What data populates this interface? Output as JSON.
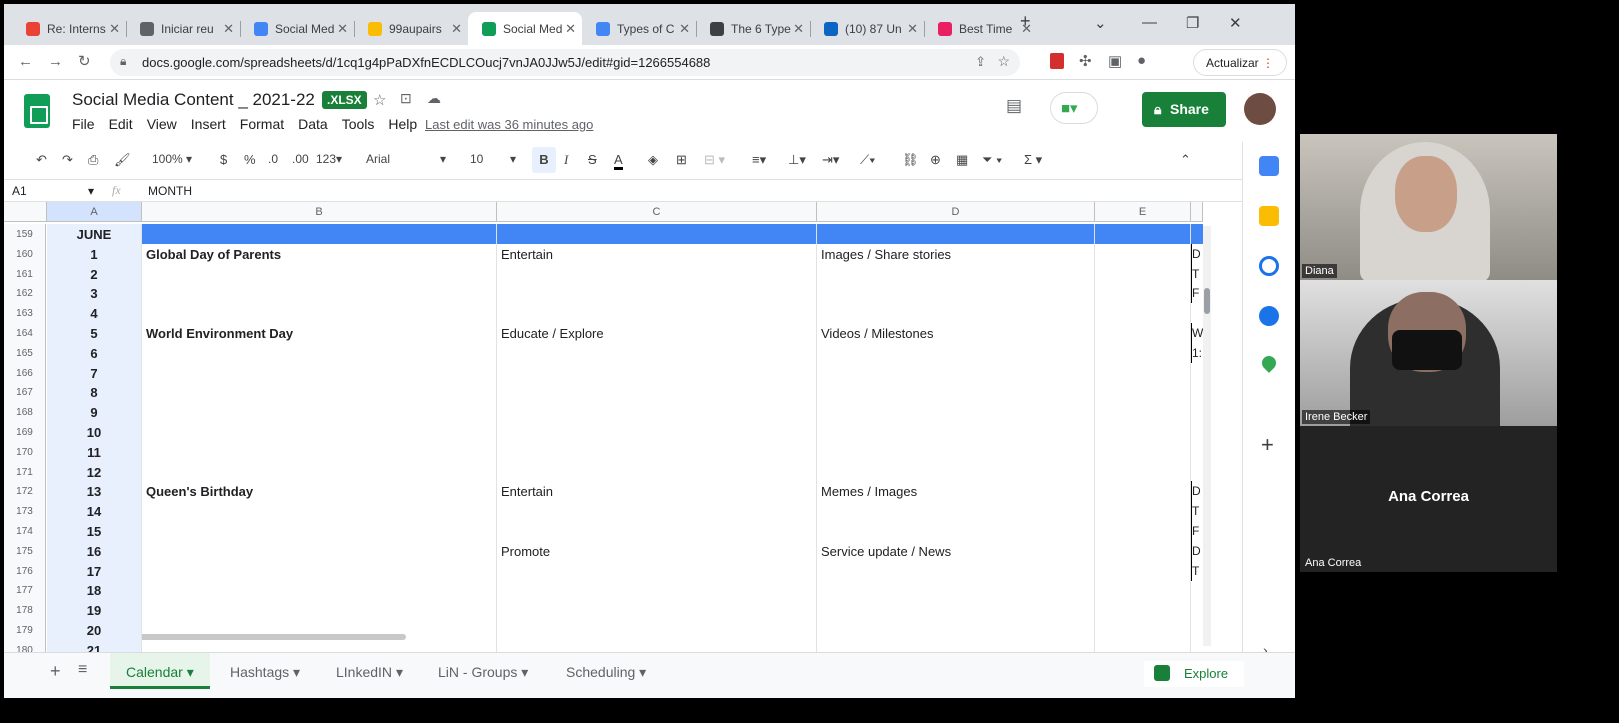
{
  "tabs": [
    {
      "label": "Re: Interns",
      "color": "#ea4335"
    },
    {
      "label": "Iniciar reu",
      "color": "#5f6368"
    },
    {
      "label": "Social Med",
      "color": "#4285f4"
    },
    {
      "label": "99aupairs",
      "color": "#fbbc04"
    },
    {
      "label": "Social Med",
      "color": "#0f9d58",
      "active": true
    },
    {
      "label": "Types of C",
      "color": "#4285f4"
    },
    {
      "label": "The 6 Type",
      "color": "#3c4043"
    },
    {
      "label": "(10) 87 Un",
      "color": "#0a66c2"
    },
    {
      "label": "Best Time",
      "color": "#e91e63"
    }
  ],
  "url": "docs.google.com/spreadsheets/d/1cq1g4pPaDXfnECDLCOucj7vnJA0JJw5J/edit#gid=1266554688",
  "update_label": "Actualizar",
  "doc": {
    "title": "Social Media Content _ 2021-22",
    "badge": ".XLSX",
    "last_edit": "Last edit was 36 minutes ago"
  },
  "menu": [
    "File",
    "Edit",
    "View",
    "Insert",
    "Format",
    "Data",
    "Tools",
    "Help"
  ],
  "share_label": "Share",
  "toolbar": {
    "zoom": "100%",
    "currency": "$",
    "percent": "%",
    "dec_less": ".0",
    "dec_more": ".00",
    "format": "123",
    "font": "Arial",
    "size": "10",
    "bold": "B",
    "italic": "I",
    "strike": "S",
    "textcolor": "A"
  },
  "formula": {
    "cell": "A1",
    "fx": "fx",
    "value": "MONTH"
  },
  "columns": [
    "A",
    "B",
    "C",
    "D",
    "E"
  ],
  "rows": [
    {
      "n": "159",
      "a": "JUNE",
      "b": "",
      "c": "",
      "d": "",
      "f": ""
    },
    {
      "n": "160",
      "a": "1",
      "b": "Global Day of Parents",
      "c": "Entertain",
      "d": "Images / Share stories",
      "f": "D"
    },
    {
      "n": "161",
      "a": "2",
      "b": "",
      "c": "",
      "d": "",
      "f": "T"
    },
    {
      "n": "162",
      "a": "3",
      "b": "",
      "c": "",
      "d": "",
      "f": "F"
    },
    {
      "n": "163",
      "a": "4",
      "b": "",
      "c": "",
      "d": "",
      "f": ""
    },
    {
      "n": "164",
      "a": "5",
      "b": "World Environment Day",
      "c": "Educate / Explore",
      "d": "Videos / Milestones",
      "f": "W"
    },
    {
      "n": "165",
      "a": "6",
      "b": "",
      "c": "",
      "d": "",
      "f": "1:"
    },
    {
      "n": "166",
      "a": "7",
      "b": "",
      "c": "",
      "d": "",
      "f": ""
    },
    {
      "n": "167",
      "a": "8",
      "b": "",
      "c": "",
      "d": "",
      "f": ""
    },
    {
      "n": "168",
      "a": "9",
      "b": "",
      "c": "",
      "d": "",
      "f": ""
    },
    {
      "n": "169",
      "a": "10",
      "b": "",
      "c": "",
      "d": "",
      "f": ""
    },
    {
      "n": "170",
      "a": "11",
      "b": "",
      "c": "",
      "d": "",
      "f": ""
    },
    {
      "n": "171",
      "a": "12",
      "b": "",
      "c": "",
      "d": "",
      "f": ""
    },
    {
      "n": "172",
      "a": "13",
      "b": "Queen's Birthday",
      "c": "Entertain",
      "d": "Memes / Images",
      "f": "D"
    },
    {
      "n": "173",
      "a": "14",
      "b": "",
      "c": "",
      "d": "",
      "f": "T"
    },
    {
      "n": "174",
      "a": "15",
      "b": "",
      "c": "",
      "d": "",
      "f": "F"
    },
    {
      "n": "175",
      "a": "16",
      "b": "",
      "c": "Promote",
      "d": "Service update / News",
      "f": "D"
    },
    {
      "n": "176",
      "a": "17",
      "b": "",
      "c": "",
      "d": "",
      "f": "T"
    },
    {
      "n": "177",
      "a": "18",
      "b": "",
      "c": "",
      "d": "",
      "f": ""
    },
    {
      "n": "178",
      "a": "19",
      "b": "",
      "c": "",
      "d": "",
      "f": ""
    },
    {
      "n": "179",
      "a": "20",
      "b": "",
      "c": "",
      "d": "",
      "f": ""
    },
    {
      "n": "180",
      "a": "21",
      "b": "",
      "c": "",
      "d": "",
      "f": ""
    }
  ],
  "sheet_tabs": [
    "Calendar",
    "Hashtags",
    "LInkedIN",
    "LiN - Groups",
    "Scheduling"
  ],
  "explore_label": "Explore",
  "participants": [
    {
      "name": "Diana",
      "center": ""
    },
    {
      "name": "Irene Becker",
      "center": ""
    },
    {
      "name": "Ana Correa",
      "center": "Ana Correa"
    }
  ],
  "colors": {
    "brand": "#188038",
    "month_band": "#4285f4",
    "selected_col": "#e8f0fe"
  }
}
